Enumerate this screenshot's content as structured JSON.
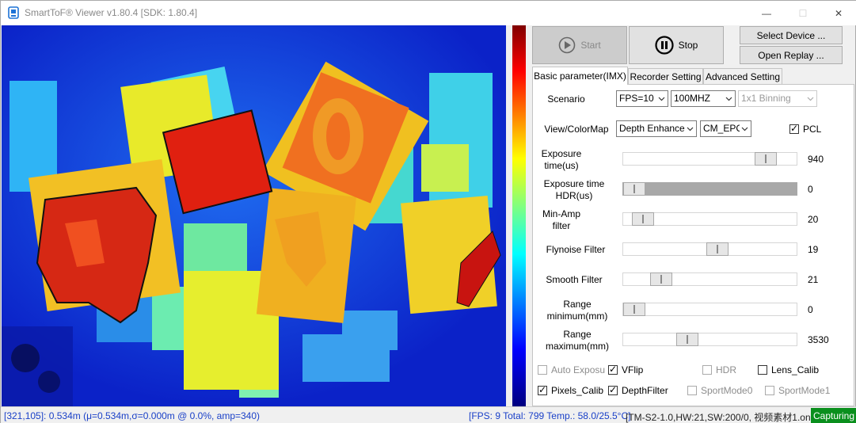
{
  "window": {
    "title": "SmartToF® Viewer v1.80.4 [SDK: 1.80.4]",
    "min_glyph": "—",
    "max_glyph": "☐",
    "close_glyph": "✕"
  },
  "toolbar": {
    "start_label": "Start",
    "stop_label": "Stop",
    "select_device_label": "Select Device ...",
    "open_replay_label": "Open Replay ..."
  },
  "tabs": [
    {
      "label": "Basic parameter(IMX)",
      "active": true
    },
    {
      "label": "Recorder Setting",
      "active": false
    },
    {
      "label": "Advanced Setting",
      "active": false
    }
  ],
  "basic": {
    "scenario_label": "Scenario",
    "scenario_fps": "FPS=10",
    "scenario_freq": "100MHZ",
    "scenario_binning": "1x1 Binning",
    "view_label": "View/ColorMap",
    "view_mode": "Depth Enhance",
    "colormap": "CM_EPC",
    "pcl_label": "PCL",
    "sliders": [
      {
        "label": "Exposure time(us)",
        "value": "940",
        "pos": 0.87
      },
      {
        "label": "Exposure time HDR(us)",
        "value": "0",
        "pos": 0.0
      },
      {
        "label": "Min-Amp filter",
        "value": "20",
        "pos": 0.06
      },
      {
        "label": "Flynoise Filter",
        "value": "19",
        "pos": 0.55
      },
      {
        "label": "Smooth Filter",
        "value": "21",
        "pos": 0.18
      },
      {
        "label": "Range minimum(mm)",
        "value": "0",
        "pos": 0.0
      },
      {
        "label": "Range maximum(mm)",
        "value": "3530",
        "pos": 0.35
      }
    ],
    "checks": {
      "auto_exposure": "Auto Exposu",
      "vflip": "VFlip",
      "hdr": "HDR",
      "lens_calib": "Lens_Calib",
      "pixels_calib": "Pixels_Calib",
      "depth_filter": "DepthFilter",
      "sport_mode0": "SportMode0",
      "sport_mode1": "SportMode1"
    }
  },
  "status": {
    "pixel_info": "[321,105]: 0.534m (μ=0.534m,σ=0.000m @ 0.0%, amp=340)",
    "fps_info": "[FPS: 9 Total: 799 Temp.: 58.0/25.5°C]",
    "device_info": "[TM-S2-1.0,HW:21,SW:200/0, 视频素材1.oni]",
    "state": "Capturing"
  },
  "colors": {
    "capturing_bg": "#0a8f1d",
    "status_blue": "#1a40c8",
    "depth_background": "#0b22c8"
  },
  "icons": {
    "start": "play-circle-icon",
    "stop": "pause-circle-icon",
    "app": "smarttof-app-icon"
  }
}
